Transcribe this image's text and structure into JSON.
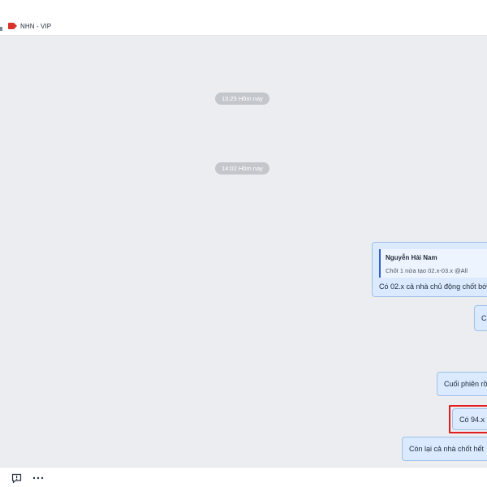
{
  "header": {
    "title": "NHN - VIP",
    "tag_color": "#d9322c"
  },
  "chat": {
    "timestamps": [
      {
        "label": "13:25 Hôm nay"
      },
      {
        "label": "14:02 Hôm nay"
      }
    ],
    "messages": [
      {
        "type": "reply",
        "quote_author": "Nguyễn Hải Nam",
        "quote_text": "Chốt 1 nửa tạo 02.x-03.x @All",
        "text": "Có 02.x cả nhà chủ động chốt bớ"
      },
      {
        "type": "text",
        "text": "C"
      },
      {
        "type": "text",
        "text": "Cuối phiên rồ"
      },
      {
        "type": "text",
        "text": "Có 94.x l",
        "highlighted": true
      },
      {
        "type": "text",
        "text": "Còn lại cả nhà chốt hết"
      }
    ],
    "bubble_color": "#dbeafe",
    "highlight_color": "#e01e1e"
  },
  "footer": {
    "icons": [
      "quick-message-icon",
      "more-options-icon"
    ]
  }
}
